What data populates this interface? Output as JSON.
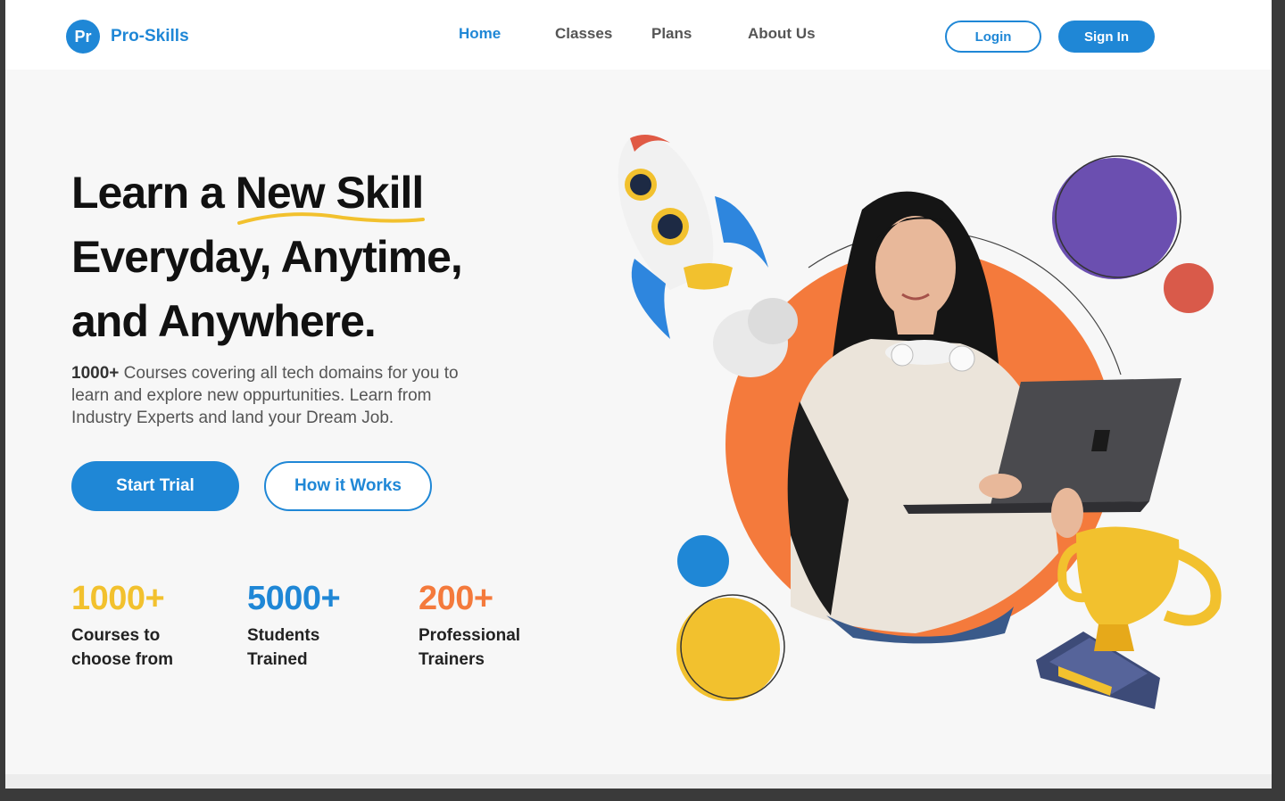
{
  "brand": {
    "badge": "Pr",
    "name": "Pro-Skills"
  },
  "nav": {
    "items": [
      {
        "label": "Home",
        "active": true
      },
      {
        "label": "Classes",
        "active": false
      },
      {
        "label": "Plans",
        "active": false
      },
      {
        "label": "About Us",
        "active": false
      }
    ],
    "login_label": "Login",
    "signin_label": "Sign In"
  },
  "hero": {
    "title_line1_pre": "Learn a ",
    "title_line1_highlight": "New Skill",
    "title_line2": "Everyday, Anytime,",
    "title_line3": "and Anywhere.",
    "desc_strong": "1000+",
    "desc_rest": " Courses covering all tech domains for you to learn and explore new oppurtunities. Learn from Industry Experts and land your Dream Job.",
    "start_trial_label": "Start Trial",
    "how_it_works_label": "How it Works"
  },
  "stats": [
    {
      "number": "1000+",
      "label_line1": "Courses to",
      "label_line2": "choose from",
      "color": "#f2c12e"
    },
    {
      "number": "5000+",
      "label_line1": "Students",
      "label_line2": "Trained",
      "color": "#1f87d6"
    },
    {
      "number": "200+",
      "label_line1": "Professional",
      "label_line2": "Trainers",
      "color": "#f47a3c"
    }
  ],
  "colors": {
    "primary": "#1f87d6",
    "accent_yellow": "#f2c12e",
    "accent_orange": "#f47a3c",
    "accent_purple": "#6b4fb0",
    "accent_red": "#d95a4a"
  },
  "icons": [
    "rocket-icon",
    "trophy-icon"
  ]
}
